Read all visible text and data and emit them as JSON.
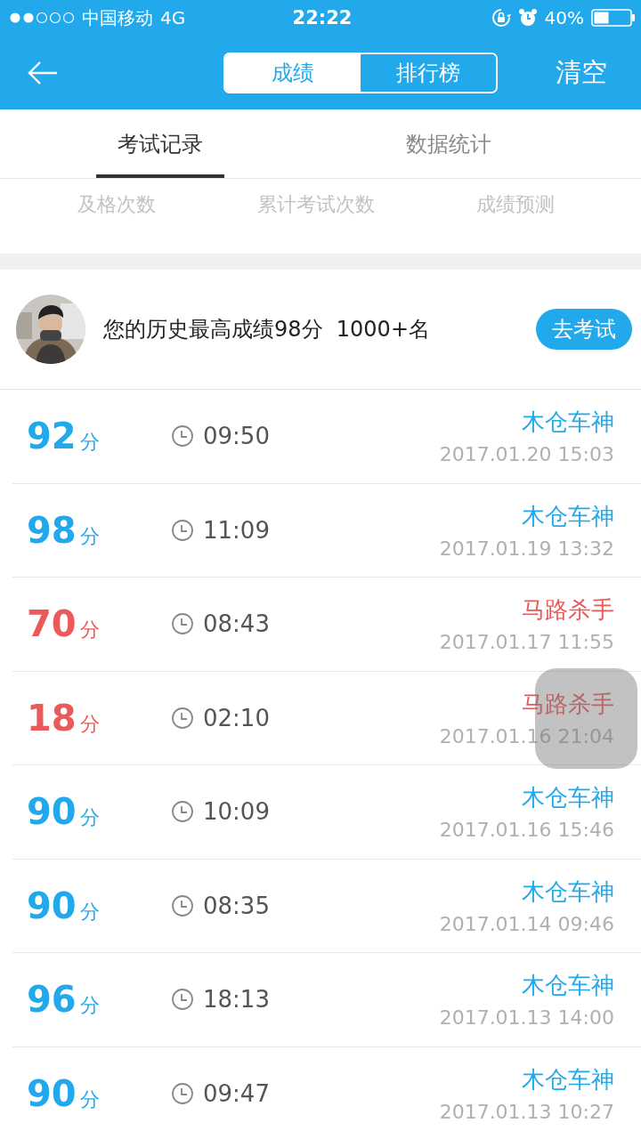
{
  "status_bar": {
    "carrier": "中国移动",
    "network": "4G",
    "time": "22:22",
    "battery": "40%"
  },
  "nav": {
    "segments": [
      {
        "label": "成绩",
        "selected": true
      },
      {
        "label": "排行榜",
        "selected": false
      }
    ],
    "action": "清空"
  },
  "tabs": [
    {
      "label": "考试记录",
      "selected": true
    },
    {
      "label": "数据统计",
      "selected": false
    }
  ],
  "stats": [
    "及格次数",
    "累计考试次数",
    "成绩预测"
  ],
  "profile": {
    "text": "您的历史最高成绩98分  1000+名",
    "button": "去考试"
  },
  "records": [
    {
      "score": "92",
      "unit": "分",
      "passed": true,
      "duration": "09:50",
      "title": "木仓车神",
      "date": "2017.01.20 15:03"
    },
    {
      "score": "98",
      "unit": "分",
      "passed": true,
      "duration": "11:09",
      "title": "木仓车神",
      "date": "2017.01.19 13:32"
    },
    {
      "score": "70",
      "unit": "分",
      "passed": false,
      "duration": "08:43",
      "title": "马路杀手",
      "date": "2017.01.17 11:55"
    },
    {
      "score": "18",
      "unit": "分",
      "passed": false,
      "duration": "02:10",
      "title": "马路杀手",
      "date": "2017.01.16 21:04"
    },
    {
      "score": "90",
      "unit": "分",
      "passed": true,
      "duration": "10:09",
      "title": "木仓车神",
      "date": "2017.01.16 15:46"
    },
    {
      "score": "90",
      "unit": "分",
      "passed": true,
      "duration": "08:35",
      "title": "木仓车神",
      "date": "2017.01.14 09:46"
    },
    {
      "score": "96",
      "unit": "分",
      "passed": true,
      "duration": "18:13",
      "title": "木仓车神",
      "date": "2017.01.13 14:00"
    },
    {
      "score": "90",
      "unit": "分",
      "passed": true,
      "duration": "09:47",
      "title": "木仓车神",
      "date": "2017.01.13 10:27"
    }
  ]
}
